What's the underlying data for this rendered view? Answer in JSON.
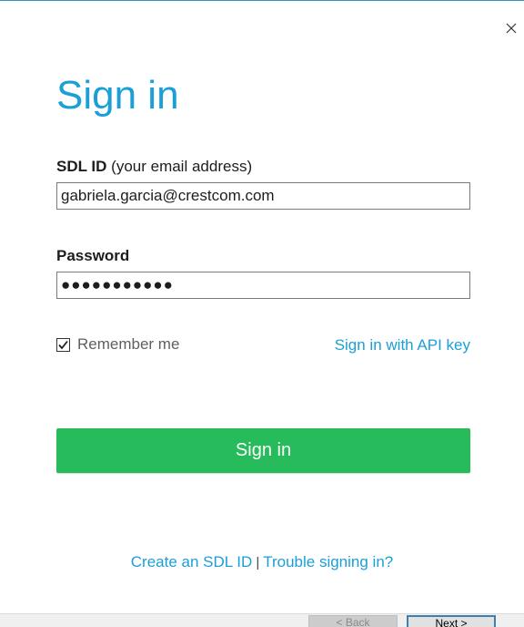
{
  "dialog": {
    "title": "Sign in",
    "close_icon": "close-icon"
  },
  "form": {
    "id_label_bold": "SDL ID",
    "id_label_hint": "(your email address)",
    "id_value": "gabriela.garcia@crestcom.com",
    "password_label": "Password",
    "password_value": "●●●●●●●●●●●",
    "remember_label": "Remember me",
    "remember_checked": true,
    "api_key_link": "Sign in with API key",
    "submit_label": "Sign in"
  },
  "footer": {
    "create_link": "Create an SDL ID",
    "separator": "|",
    "trouble_link": "Trouble signing in?"
  },
  "wizard": {
    "back_label": "< Back",
    "next_label": "Next >"
  },
  "colors": {
    "accent": "#1a9fd8",
    "submit_bg": "#27bb5b"
  }
}
